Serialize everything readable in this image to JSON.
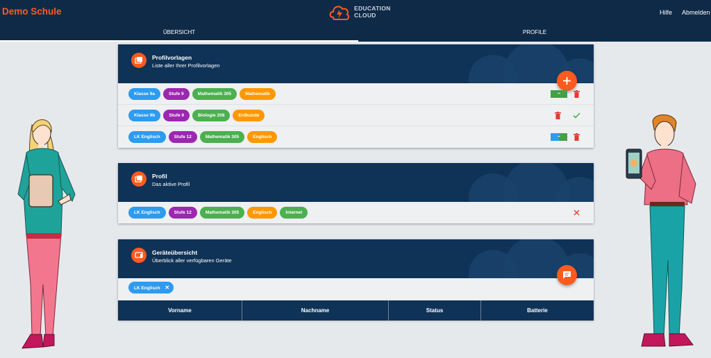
{
  "app": {
    "brand": "Demo Schule",
    "logo_line1": "EDUCATION",
    "logo_line2": "CLOUD"
  },
  "header": {
    "help": "Hilfe",
    "logout": "Abmelden"
  },
  "tabs": [
    {
      "label": "ÜBERSICHT",
      "active": true
    },
    {
      "label": "PROFILE",
      "active": false
    }
  ],
  "colors": {
    "accent": "#ff5a1f",
    "header_bg": "#0f2a47",
    "card_head": "#0f3257",
    "chip_blue": "#2d9bf0",
    "chip_purple": "#9c27b0",
    "chip_green": "#4caf50",
    "chip_orange": "#ff9800",
    "delete": "#e53935"
  },
  "templates_card": {
    "title": "Profilvorlagen",
    "subtitle": "Liste aller Ihrer Profilvorlagen",
    "rows": [
      {
        "chips": [
          "Klasse 9a",
          "Stufe 9",
          "Mathematik 305",
          "Mathematik"
        ]
      },
      {
        "chips": [
          "Klasse 9b",
          "Stufe 9",
          "Biologie 208",
          "Erdkunde"
        ]
      },
      {
        "chips": [
          "LK Englisch",
          "Stufe 12",
          "Mathematik 305",
          "Englisch"
        ]
      }
    ]
  },
  "profile_card": {
    "title": "Profil",
    "subtitle": "Das aktive Profil",
    "chips": [
      "LK Englisch",
      "Stufe 12",
      "Mathematik 305",
      "Englisch",
      "Internet"
    ]
  },
  "devices_card": {
    "title": "Geräteübersicht",
    "subtitle": "Überblick aller verfügbaren Geräte",
    "filter_chip": "LK Englisch",
    "columns": [
      "Vorname",
      "Nachname",
      "Status",
      "Batterie"
    ]
  },
  "icons": [
    "add-icon",
    "delete-icon",
    "check-icon",
    "close-icon",
    "chat-icon",
    "profile-card-icon",
    "device-icon"
  ]
}
